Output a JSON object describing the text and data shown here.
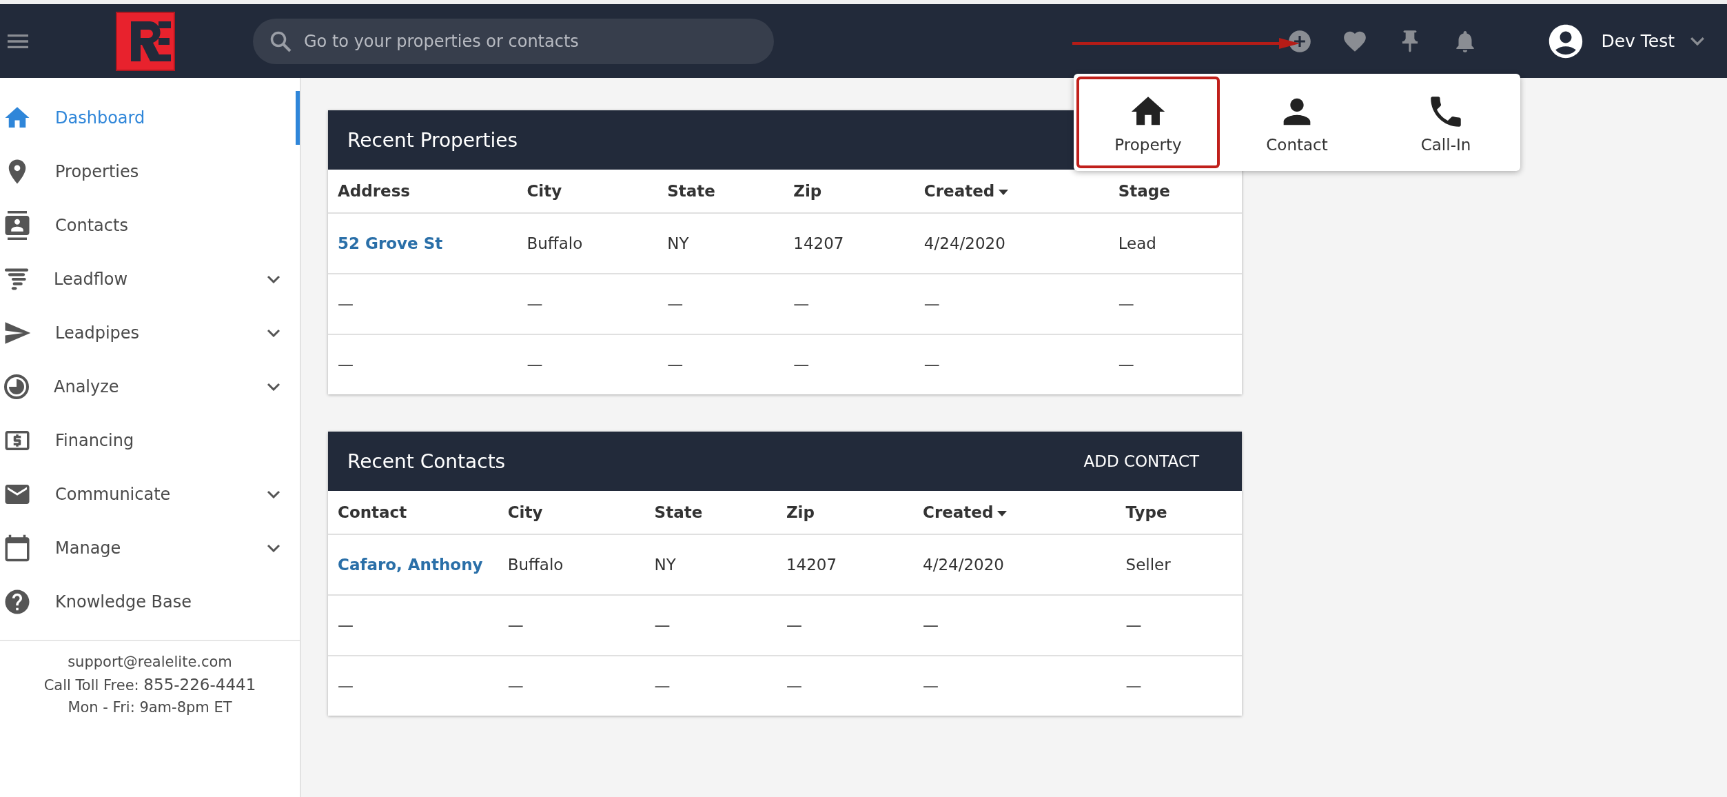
{
  "top_bar": {
    "search": {
      "placeholder": "Go to your properties or contacts"
    },
    "user": {
      "name": "Dev Test"
    }
  },
  "add_menu": {
    "items": [
      {
        "label": "Property",
        "highlighted": true
      },
      {
        "label": "Contact",
        "highlighted": false
      },
      {
        "label": "Call-In",
        "highlighted": false
      }
    ]
  },
  "sidebar": {
    "items": [
      {
        "label": "Dashboard",
        "selected": true,
        "expandable": false
      },
      {
        "label": "Properties",
        "selected": false,
        "expandable": false
      },
      {
        "label": "Contacts",
        "selected": false,
        "expandable": false
      },
      {
        "label": "Leadflow",
        "selected": false,
        "expandable": true
      },
      {
        "label": "Leadpipes",
        "selected": false,
        "expandable": true
      },
      {
        "label": "Analyze",
        "selected": false,
        "expandable": true
      },
      {
        "label": "Financing",
        "selected": false,
        "expandable": false
      },
      {
        "label": "Communicate",
        "selected": false,
        "expandable": true
      },
      {
        "label": "Manage",
        "selected": false,
        "expandable": true
      },
      {
        "label": "Knowledge Base",
        "selected": false,
        "expandable": false
      }
    ],
    "footer": {
      "email": "support@realelite.com",
      "phone_label": "Call Toll Free:",
      "phone": "855-226-4441",
      "hours": "Mon - Fri: 9am-8pm ET"
    }
  },
  "cards": [
    {
      "title": "Recent Properties",
      "columns": [
        {
          "label": "Address",
          "sorted": false
        },
        {
          "label": "City",
          "sorted": false
        },
        {
          "label": "State",
          "sorted": false
        },
        {
          "label": "Zip",
          "sorted": false
        },
        {
          "label": "Created",
          "sorted": true
        },
        {
          "label": "Stage",
          "sorted": false
        }
      ],
      "rows": [
        [
          "52 Grove St",
          "Buffalo",
          "NY",
          "14207",
          "4/24/2020",
          "Lead"
        ],
        [
          "—",
          "—",
          "—",
          "—",
          "—",
          "—"
        ],
        [
          "—",
          "—",
          "—",
          "—",
          "—",
          "—"
        ]
      ]
    },
    {
      "title": "Recent Contacts",
      "action": "ADD CONTACT",
      "columns": [
        {
          "label": "Contact",
          "sorted": false
        },
        {
          "label": "City",
          "sorted": false
        },
        {
          "label": "State",
          "sorted": false
        },
        {
          "label": "Zip",
          "sorted": false
        },
        {
          "label": "Created",
          "sorted": true
        },
        {
          "label": "Type",
          "sorted": false
        }
      ],
      "rows": [
        [
          "Cafaro, Anthony",
          "Buffalo",
          "NY",
          "14207",
          "4/24/2020",
          "Seller"
        ],
        [
          "—",
          "—",
          "—",
          "—",
          "—",
          "—"
        ],
        [
          "—",
          "—",
          "—",
          "—",
          "—",
          "—"
        ]
      ]
    }
  ]
}
